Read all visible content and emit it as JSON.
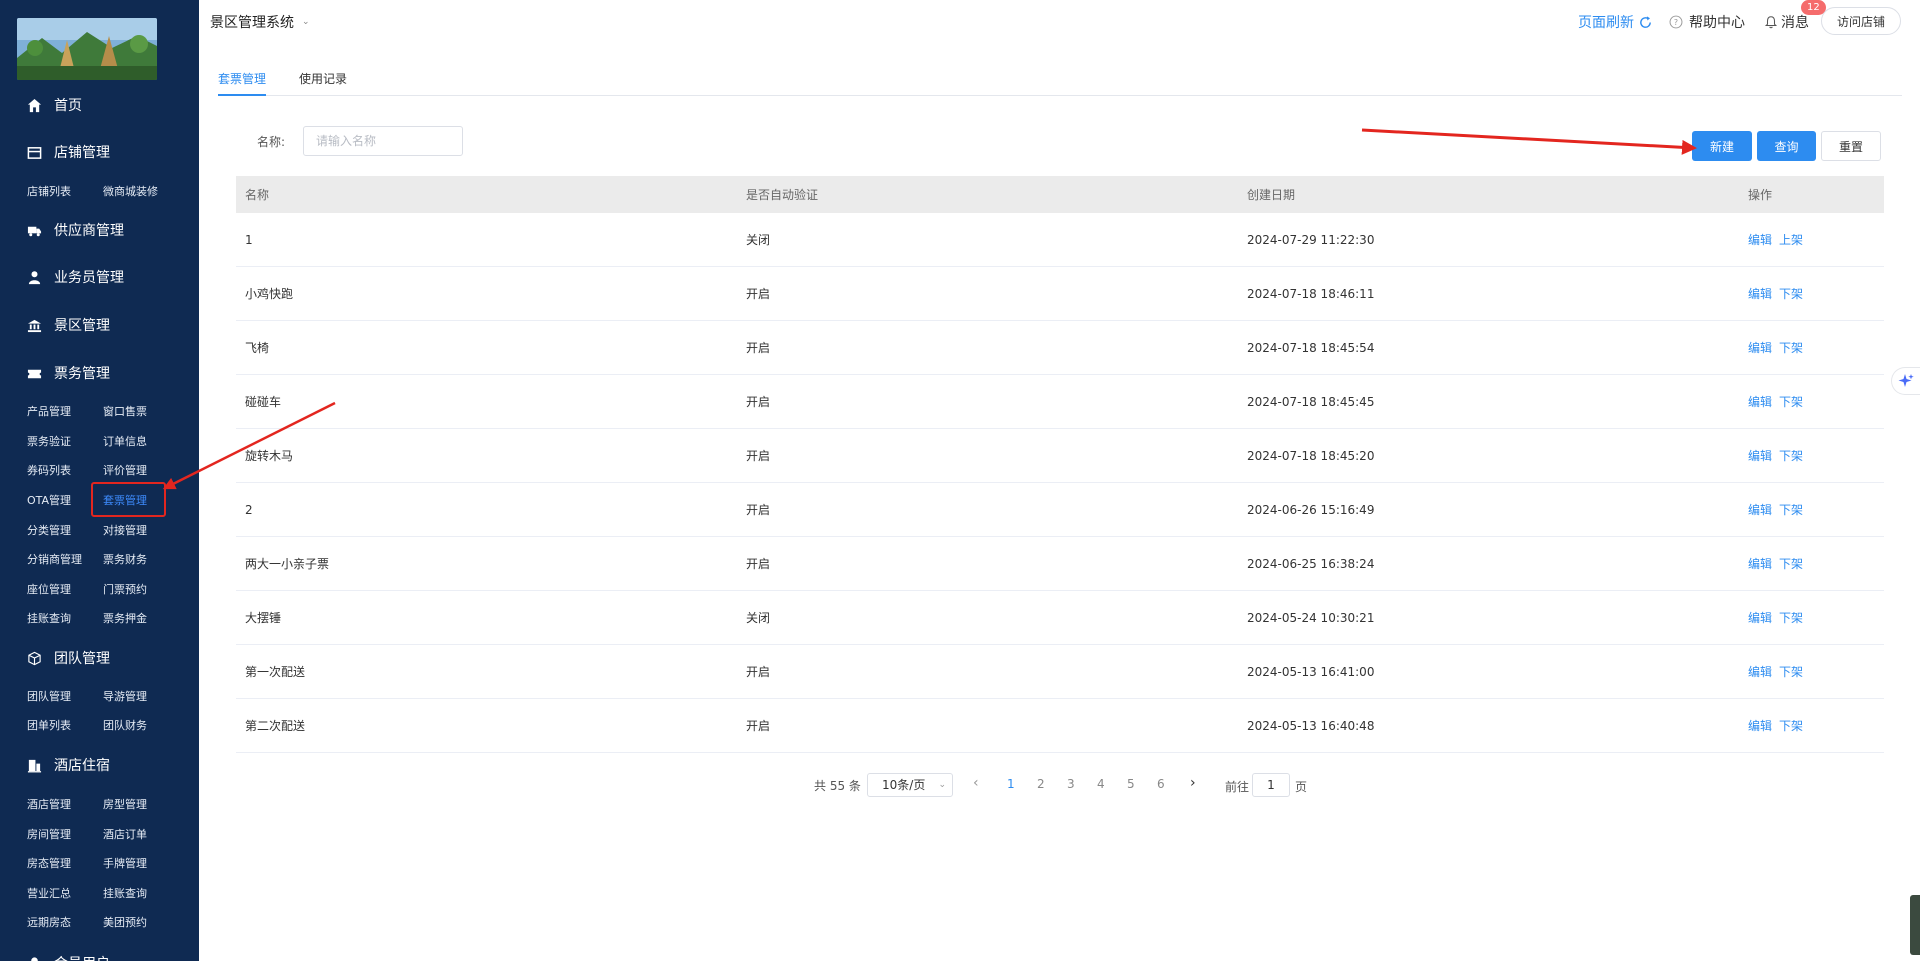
{
  "app": {
    "title": "景区管理系统"
  },
  "header": {
    "refresh_label": "页面刷新",
    "help_label": "帮助中心",
    "message_label": "消息",
    "message_count": "12",
    "visit_store_label": "访问店铺"
  },
  "sidebar": {
    "home": "首页",
    "store": {
      "label": "店铺管理",
      "items": [
        "店铺列表",
        "微商城装修"
      ]
    },
    "supplier": "供应商管理",
    "salesman": "业务员管理",
    "scenic": "景区管理",
    "ticket": {
      "label": "票务管理",
      "items": [
        "产品管理",
        "窗口售票",
        "票务验证",
        "订单信息",
        "券码列表",
        "评价管理",
        "OTA管理",
        "套票管理",
        "分类管理",
        "对接管理",
        "分销商管理",
        "票务财务",
        "座位管理",
        "门票预约",
        "挂账查询",
        "票务押金"
      ]
    },
    "team": {
      "label": "团队管理",
      "items": [
        "团队管理",
        "导游管理",
        "团单列表",
        "团队财务"
      ]
    },
    "hotel": {
      "label": "酒店住宿",
      "items": [
        "酒店管理",
        "房型管理",
        "房间管理",
        "酒店订单",
        "房态管理",
        "手牌管理",
        "营业汇总",
        "挂账查询",
        "远期房态",
        "美团预约"
      ]
    },
    "member_partial": "会员用户"
  },
  "tabs": [
    "套票管理",
    "使用记录"
  ],
  "filter": {
    "name_label": "名称:",
    "name_placeholder": "请输入名称"
  },
  "actions": {
    "new": "新建",
    "query": "查询",
    "reset": "重置"
  },
  "table": {
    "headers": [
      "名称",
      "是否自动验证",
      "创建日期",
      "操作"
    ],
    "rows": [
      {
        "name": "1",
        "auto": "关闭",
        "date": "2024-07-29 11:22:30",
        "edit": "编辑",
        "toggle": "上架"
      },
      {
        "name": "小鸡快跑",
        "auto": "开启",
        "date": "2024-07-18 18:46:11",
        "edit": "编辑",
        "toggle": "下架"
      },
      {
        "name": "飞椅",
        "auto": "开启",
        "date": "2024-07-18 18:45:54",
        "edit": "编辑",
        "toggle": "下架"
      },
      {
        "name": "碰碰车",
        "auto": "开启",
        "date": "2024-07-18 18:45:45",
        "edit": "编辑",
        "toggle": "下架"
      },
      {
        "name": "旋转木马",
        "auto": "开启",
        "date": "2024-07-18 18:45:20",
        "edit": "编辑",
        "toggle": "下架"
      },
      {
        "name": "2",
        "auto": "开启",
        "date": "2024-06-26 15:16:49",
        "edit": "编辑",
        "toggle": "下架"
      },
      {
        "name": "两大一小亲子票",
        "auto": "开启",
        "date": "2024-06-25 16:38:24",
        "edit": "编辑",
        "toggle": "下架"
      },
      {
        "name": "大摆锤",
        "auto": "关闭",
        "date": "2024-05-24 10:30:21",
        "edit": "编辑",
        "toggle": "下架"
      },
      {
        "name": "第一次配送",
        "auto": "开启",
        "date": "2024-05-13 16:41:00",
        "edit": "编辑",
        "toggle": "下架"
      },
      {
        "name": "第二次配送",
        "auto": "开启",
        "date": "2024-05-13 16:40:48",
        "edit": "编辑",
        "toggle": "下架"
      }
    ]
  },
  "pagination": {
    "total": "共 55 条",
    "page_size": "10条/页",
    "pages": [
      "1",
      "2",
      "3",
      "4",
      "5",
      "6"
    ],
    "current": "1",
    "goto_label": "前往",
    "goto_value": "1",
    "page_suffix": "页"
  },
  "colors": {
    "sidebar_bg": "#0f2a52",
    "primary": "#2d8cf0",
    "annotation_red": "#e3261f",
    "badge_red": "#f56c6c"
  }
}
